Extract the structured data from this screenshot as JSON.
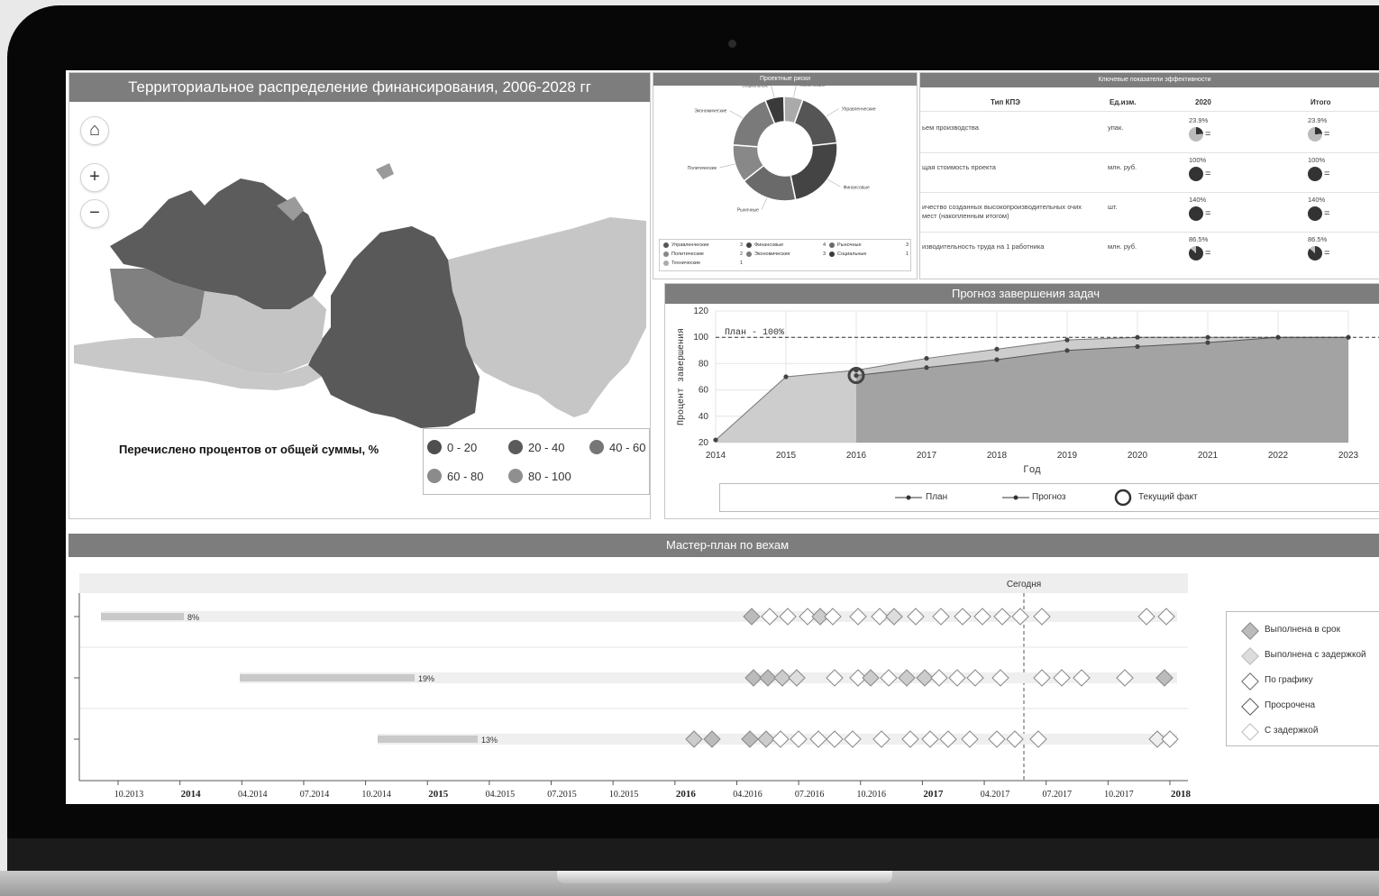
{
  "map": {
    "title": "Территориальное распределение финансирования, 2006-2028 гг",
    "legend_title": "Перечислено процентов от общей суммы, %",
    "legend": [
      {
        "label": "0 - 20",
        "color": "#4f4f4f"
      },
      {
        "label": "20 - 40",
        "color": "#5b5b5b"
      },
      {
        "label": "40 - 60",
        "color": "#767676"
      },
      {
        "label": "60 - 80",
        "color": "#8b8b8b"
      },
      {
        "label": "80 - 100",
        "color": "#8f8f8f"
      }
    ],
    "controls": {
      "home": "⌂",
      "zoom_in": "+",
      "zoom_out": "−"
    }
  },
  "risks": {
    "title": "Проектные риски",
    "chart_data": {
      "type": "pie",
      "categories": [
        "Управленческие",
        "Финансовые",
        "Рыночные",
        "Политические",
        "Экономические",
        "Социальные",
        "Технические"
      ],
      "values": [
        3,
        4,
        3,
        2,
        3,
        1,
        1
      ]
    },
    "legend_rows": [
      [
        "Управленческие",
        "3",
        "Финансовые",
        "4",
        "Рыночные",
        "3"
      ],
      [
        "Политические",
        "2",
        "Экономические",
        "3",
        "Социальные",
        "1"
      ],
      [
        "Технические",
        "1",
        "",
        "",
        "",
        ""
      ]
    ]
  },
  "kpi": {
    "title": "Ключевые показатели эффективности",
    "headers": [
      "Тип КПЭ",
      "Ед.изм.",
      "2020",
      "Итого"
    ],
    "rows": [
      {
        "name": "ьем производства",
        "unit": "упак.",
        "v2020": "23.9%",
        "total": "23.9%",
        "fill": 0.239
      },
      {
        "name": "щая стоимость проекта",
        "unit": "млн. руб.",
        "v2020": "100%",
        "total": "100%",
        "fill": 1.0
      },
      {
        "name": "ичество созданных высокопроизводительных очих мест (накопленным итогом)",
        "unit": "шт.",
        "v2020": "140%",
        "total": "140%",
        "fill": 1.0
      },
      {
        "name": "изводительность труда на 1 работника",
        "unit": "млн. руб.",
        "v2020": "86.5%",
        "total": "86.5%",
        "fill": 0.865
      }
    ],
    "trend": "="
  },
  "forecast": {
    "title": "Прогноз завершения задач",
    "plan_label": "План - 100%",
    "chart_data": {
      "type": "line",
      "xlabel": "Год",
      "ylabel": "Процент завершения",
      "x": [
        2014,
        2015,
        2016,
        2017,
        2018,
        2019,
        2020,
        2021,
        2022,
        2023
      ],
      "ylim": [
        20,
        120
      ],
      "yticks": [
        20,
        40,
        60,
        80,
        100,
        120
      ],
      "series": [
        {
          "name": "План",
          "x": [
            2014,
            2015,
            2016,
            2017,
            2018,
            2019,
            2020,
            2021,
            2022,
            2023
          ],
          "values": [
            22,
            70,
            75,
            84,
            91,
            98,
            100,
            100,
            100,
            100
          ]
        },
        {
          "name": "Прогноз",
          "x": [
            2016,
            2017,
            2018,
            2019,
            2020,
            2021,
            2022,
            2023
          ],
          "values": [
            71,
            77,
            83,
            90,
            93,
            96,
            100,
            100
          ]
        }
      ],
      "current_fact": {
        "name": "Текущий факт",
        "x": 2016,
        "y": 71
      }
    }
  },
  "milestones": {
    "title": "Мастер-план по вехам",
    "today_label": "Сегодня",
    "rows": [
      {
        "pct": "8%"
      },
      {
        "pct": "19%"
      },
      {
        "pct": "13%"
      }
    ],
    "axis_ticks": [
      "10.2013",
      "2014",
      "04.2014",
      "07.2014",
      "10.2014",
      "2015",
      "04.2015",
      "07.2015",
      "10.2015",
      "2016",
      "04.2016",
      "07.2016",
      "10.2016",
      "2017",
      "04.2017",
      "07.2017",
      "10.2017",
      "2018"
    ],
    "legend": [
      "Выполнена в срок",
      "Выполнена с задержкой",
      "По графику",
      "Просрочена",
      "С задержкой"
    ]
  }
}
